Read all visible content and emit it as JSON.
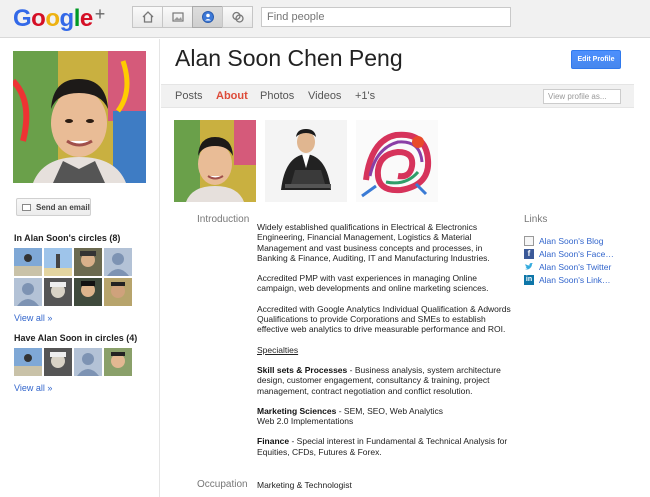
{
  "app": {
    "logo_letters": [
      "G",
      "o",
      "o",
      "g",
      "l",
      "e"
    ],
    "logo_plus": "+",
    "search_placeholder": "Find people"
  },
  "left": {
    "send_email": "Send an email",
    "in_circles_title": "In Alan Soon's circles (8)",
    "view_all_1": "View all »",
    "have_in_circles_title": "Have Alan Soon in circles (4)",
    "view_all_2": "View all »"
  },
  "profile": {
    "name": "Alan Soon Chen Peng",
    "edit_profile": "Edit Profile",
    "view_profile_as": "View profile as..."
  },
  "tabs": [
    {
      "label": "Posts",
      "active": false
    },
    {
      "label": "About",
      "active": true
    },
    {
      "label": "Photos",
      "active": false
    },
    {
      "label": "Videos",
      "active": false
    },
    {
      "label": "+1's",
      "active": false
    }
  ],
  "about": {
    "introduction_label": "Introduction",
    "p1": "Widely established qualifications in Electrical & Electronics Engineering, Financial Management, Logistics & Material Management and vast business concepts and processes, in Banking & Finance, Auditing, IT and Manufacturing Industries.",
    "p2": "Accredited PMP with vast experiences in managing Online campaign, web developments and online marketing sciences.",
    "p3": "Accredited with Google Analytics Individual Qualification & Adwords Qualifications to provide Corporations and SMEs to establish effective web analytics to drive measurable performance and ROI.",
    "specialties": "Specialties",
    "skills_title": "Skill sets & Processes",
    "skills_text": " - Business analysis, system architecture design, customer engagement, consultancy & training, project management, contract negotiation and conflict resolution.",
    "marketing_title": "Marketing Sciences",
    "marketing_text": " - SEM, SEO, Web Analytics",
    "marketing_line2": "Web 2.0 Implementations",
    "finance_title": "Finance",
    "finance_text": " - Special interest in Fundamental & Technical Analysis for Equities, CFDs, Futures & Forex.",
    "occupation_label": "Occupation",
    "occupation_value": "Marketing & Technologist"
  },
  "links": {
    "title": "Links",
    "items": [
      {
        "label": "Alan Soon's Blog",
        "icon": "blog-icon",
        "color": "#888888"
      },
      {
        "label": "Alan Soon's Face…",
        "icon": "facebook-icon",
        "color": "#3b5998"
      },
      {
        "label": "Alan Soon's Twitter",
        "icon": "twitter-icon",
        "color": "#33aadd"
      },
      {
        "label": "Alan Soon's Link…",
        "icon": "linkedin-icon",
        "color": "#0e76a8"
      }
    ]
  }
}
